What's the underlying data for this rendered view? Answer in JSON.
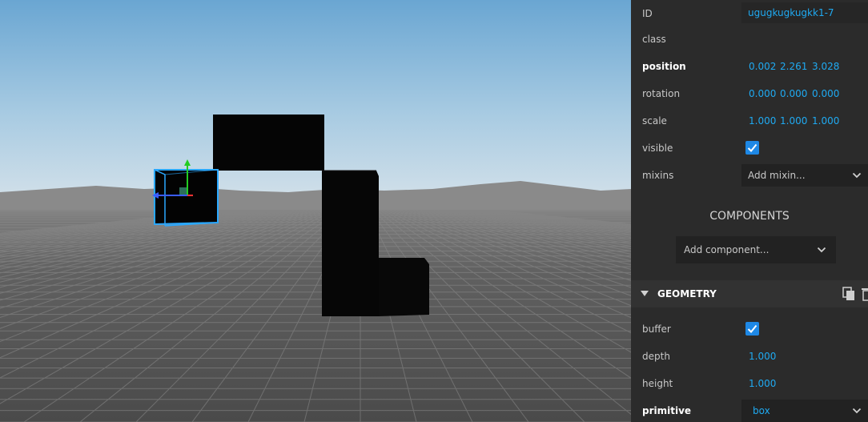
{
  "entity": {
    "id_label": "ID",
    "id_value": "ugugkugkugkk1-7",
    "class_label": "class",
    "position_label": "position",
    "position": [
      "0.002",
      "2.261",
      "3.028"
    ],
    "rotation_label": "rotation",
    "rotation": [
      "0.000",
      "0.000",
      "0.000"
    ],
    "scale_label": "scale",
    "scale": [
      "1.000",
      "1.000",
      "1.000"
    ],
    "visible_label": "visible",
    "mixins_label": "mixins",
    "mixins_placeholder": "Add mixin..."
  },
  "components": {
    "title": "COMPONENTS",
    "add_placeholder": "Add component..."
  },
  "geometry": {
    "title": "GEOMETRY",
    "buffer_label": "buffer",
    "depth_label": "depth",
    "depth": "1.000",
    "height_label": "height",
    "height": "1.000",
    "primitive_label": "primitive",
    "primitive": "box"
  },
  "colors": {
    "accent": "#1faaf2",
    "panel_bg": "#2b2b2b",
    "checkbox": "#1e88e5",
    "selection_outline": "#2aa8ff"
  },
  "icons": [
    "chevron-down-icon",
    "checkmark-icon",
    "triangle-down-icon",
    "copy-icon",
    "trash-icon",
    "translate-gizmo-icon"
  ]
}
